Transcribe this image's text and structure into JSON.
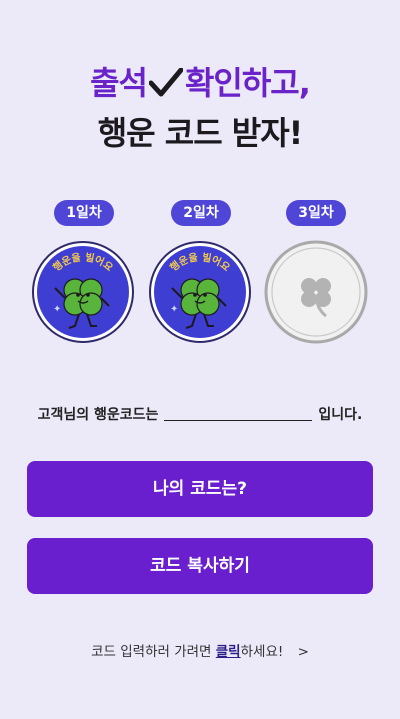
{
  "headline": {
    "line1_part1": "출석",
    "line1_part2": "확인하고,",
    "line2": "행운 코드 받자!"
  },
  "days": [
    {
      "label": "1일차",
      "stamp_text": "행운을 빌어요",
      "status": "checked"
    },
    {
      "label": "2일차",
      "stamp_text": "행운을 빌어요",
      "status": "checked"
    },
    {
      "label": "3일차",
      "stamp_text": "",
      "status": "unchecked"
    }
  ],
  "code_sentence": {
    "prefix": "고객님의 행운코드는",
    "suffix": "입니다."
  },
  "buttons": {
    "my_code": "나의 코드는?",
    "copy_code": "코드 복사하기"
  },
  "footer": {
    "prefix": "코드 입력하러 가려면",
    "link": "클릭",
    "suffix": "하세요!",
    "arrow": ">"
  },
  "colors": {
    "background": "#ece9f8",
    "accent_purple": "#6a1fcf",
    "badge_blue": "#4f45d6",
    "stamp_blue": "#3f3ed3",
    "clover_green": "#58b43a"
  },
  "icons": [
    "checkmark-icon",
    "clover-character-icon",
    "clover-outline-icon",
    "chevron-right-icon"
  ]
}
